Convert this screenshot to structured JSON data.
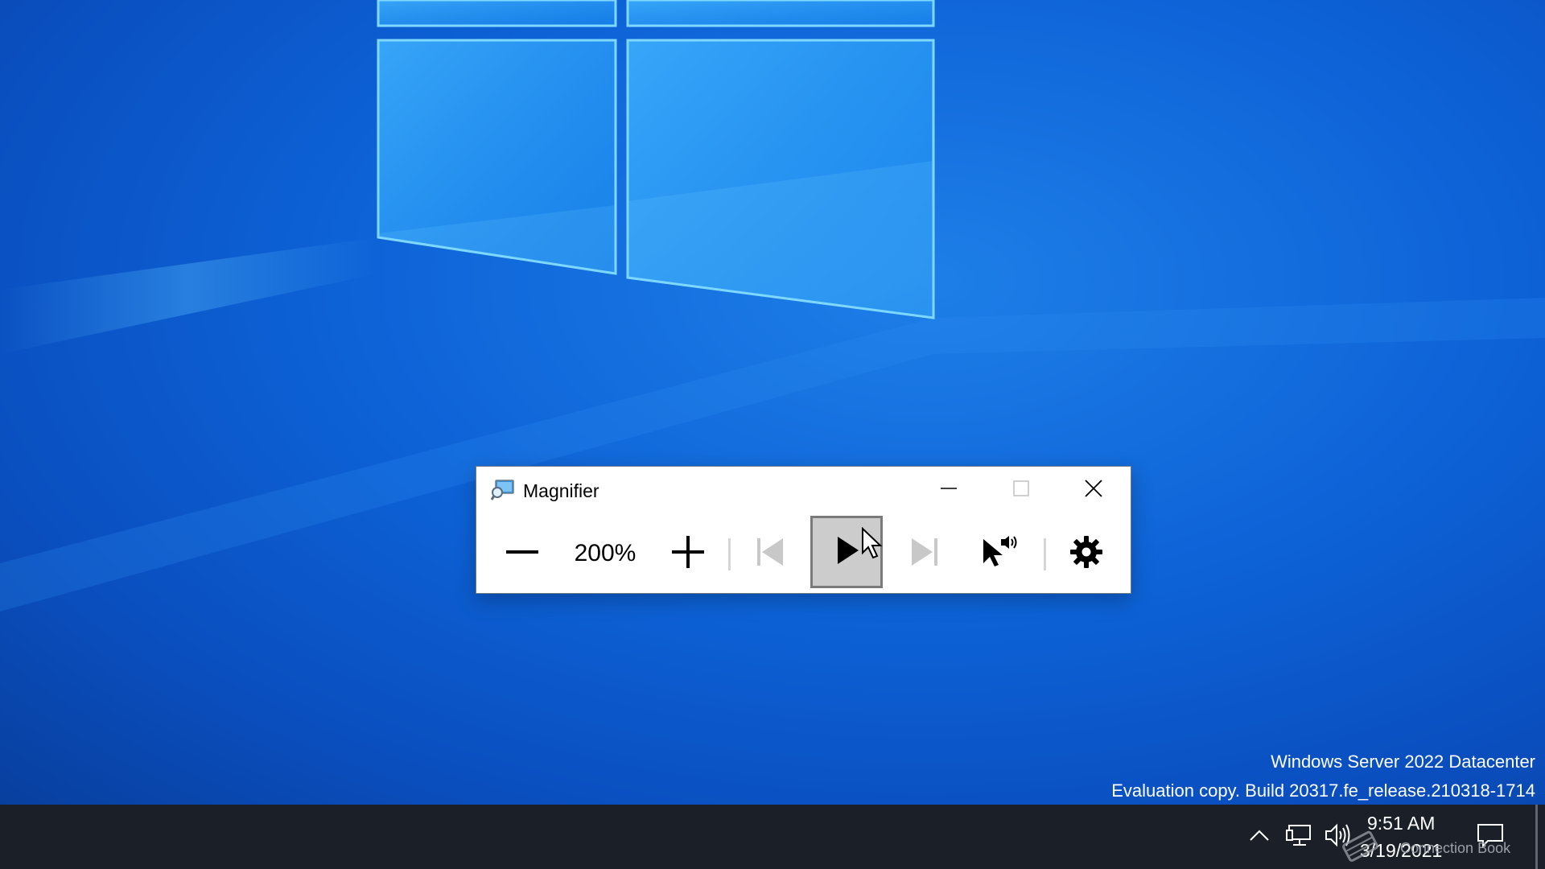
{
  "magnifier": {
    "title": "Magnifier",
    "zoom_level": "200%",
    "icons": {
      "app": "magnifier-app-icon",
      "minimize": "minimize-icon",
      "maximize": "maximize-icon",
      "close": "close-icon",
      "zoom_out": "minus-icon",
      "zoom_in": "plus-icon",
      "read_previous": "skip-back-icon",
      "read_play": "play-icon",
      "read_next": "skip-forward-icon",
      "read_from_here": "pointer-speaker-icon",
      "settings": "gear-icon"
    }
  },
  "watermark": {
    "edition": "Windows Server 2022 Datacenter",
    "build": "Evaluation copy. Build 20317.fe_release.210318-1714"
  },
  "taskbar": {
    "time": "9:51 AM",
    "date": "3/19/2021",
    "overlay_label": "Connection Book",
    "icons": {
      "chevron": "chevron-up-icon",
      "network": "network-icon",
      "volume": "volume-icon",
      "notes": "notebook-icon",
      "action_center": "notification-icon"
    }
  },
  "colors": {
    "desktop": "#0d62d6",
    "taskbar": "#1b2028",
    "play_button": "#cccccc"
  }
}
